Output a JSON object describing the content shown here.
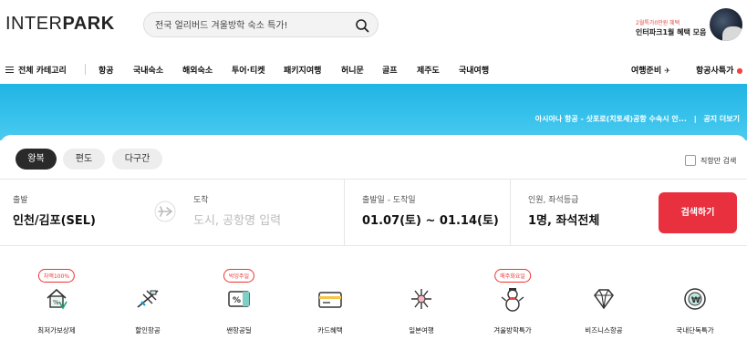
{
  "header": {
    "logo_text": "INTER",
    "logo_bold": "PARK",
    "search_placeholder": "전국 얼리버드 겨울방학 숙소 특가!",
    "promo_small": "2월특가0만원 혜택",
    "promo_main": "인터파크1월 혜택 모음"
  },
  "nav": {
    "all_categories": "전체 카테고리",
    "items": [
      "항공",
      "국내숙소",
      "해외숙소",
      "투어·티켓",
      "패키지여행",
      "허니문",
      "골프",
      "제주도",
      "국내여행"
    ],
    "right_items": [
      "여행준비",
      "항공사특가"
    ]
  },
  "banner": {
    "ticker": "아시아나 항공 - 삿포로(치토세)공항 수속시 안...",
    "notice_more": "공지 더보기"
  },
  "search": {
    "trip_types": [
      "왕복",
      "편도",
      "다구간"
    ],
    "direct_only": "직항만 검색",
    "depart_label": "출발",
    "depart_value": "인천/김포(SEL)",
    "arrive_label": "도착",
    "arrive_placeholder": "도시, 공항명 입력",
    "dates_label": "출발일 - 도착일",
    "dates_value": "01.07(토) ~ 01.14(토)",
    "pax_label": "인원, 좌석등급",
    "pax_value": "1명, 좌석전체",
    "search_button": "검색하기"
  },
  "quick": [
    {
      "badge": "차액100%",
      "label": "최저가보상제",
      "icon": "price-guarantee-icon"
    },
    {
      "badge": "",
      "label": "할인항공",
      "icon": "discount-plane-icon"
    },
    {
      "badge": "박잉주일",
      "label": "쌘항공딜",
      "icon": "percent-ticket-icon"
    },
    {
      "badge": "",
      "label": "카드혜택",
      "icon": "credit-card-icon"
    },
    {
      "badge": "",
      "label": "일본여행",
      "icon": "japan-travel-icon"
    },
    {
      "badge": "매주화요일",
      "label": "겨울방학특가",
      "icon": "snowman-icon"
    },
    {
      "badge": "",
      "label": "비즈니스항공",
      "icon": "diamond-icon"
    },
    {
      "badge": "",
      "label": "국내단독특가",
      "icon": "won-coin-icon"
    }
  ],
  "colors": {
    "accent_red": "#e8303f",
    "banner_blue": "#2ab8e8"
  }
}
